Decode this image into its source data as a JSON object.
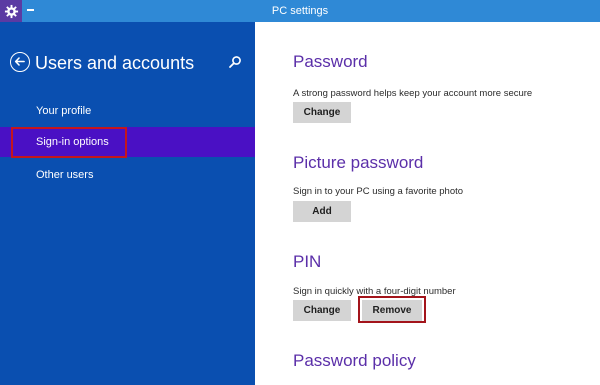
{
  "window": {
    "title": "PC settings"
  },
  "sidebar": {
    "heading": "Users and accounts",
    "items": [
      {
        "label": "Your profile",
        "selected": false
      },
      {
        "label": "Sign-in options",
        "selected": true
      },
      {
        "label": "Other users",
        "selected": false
      }
    ]
  },
  "sections": {
    "password": {
      "title": "Password",
      "description": "A strong password helps keep your account more secure",
      "button": "Change"
    },
    "picture_password": {
      "title": "Picture password",
      "description": "Sign in to your PC using a favorite photo",
      "button": "Add"
    },
    "pin": {
      "title": "PIN",
      "description": "Sign in quickly with a four-digit number",
      "change_button": "Change",
      "remove_button": "Remove"
    },
    "password_policy": {
      "title": "Password policy"
    }
  },
  "icons": {
    "app": "gear-icon",
    "menu": "menu-icon",
    "back": "back-arrow-icon",
    "search": "search-icon"
  },
  "colors": {
    "titlebar": "#2f89d6",
    "sidebar": "#0a4fb0",
    "selected_item": "#4a10c4",
    "accent_text": "#5b2fa9",
    "highlight": "#c4161c"
  }
}
